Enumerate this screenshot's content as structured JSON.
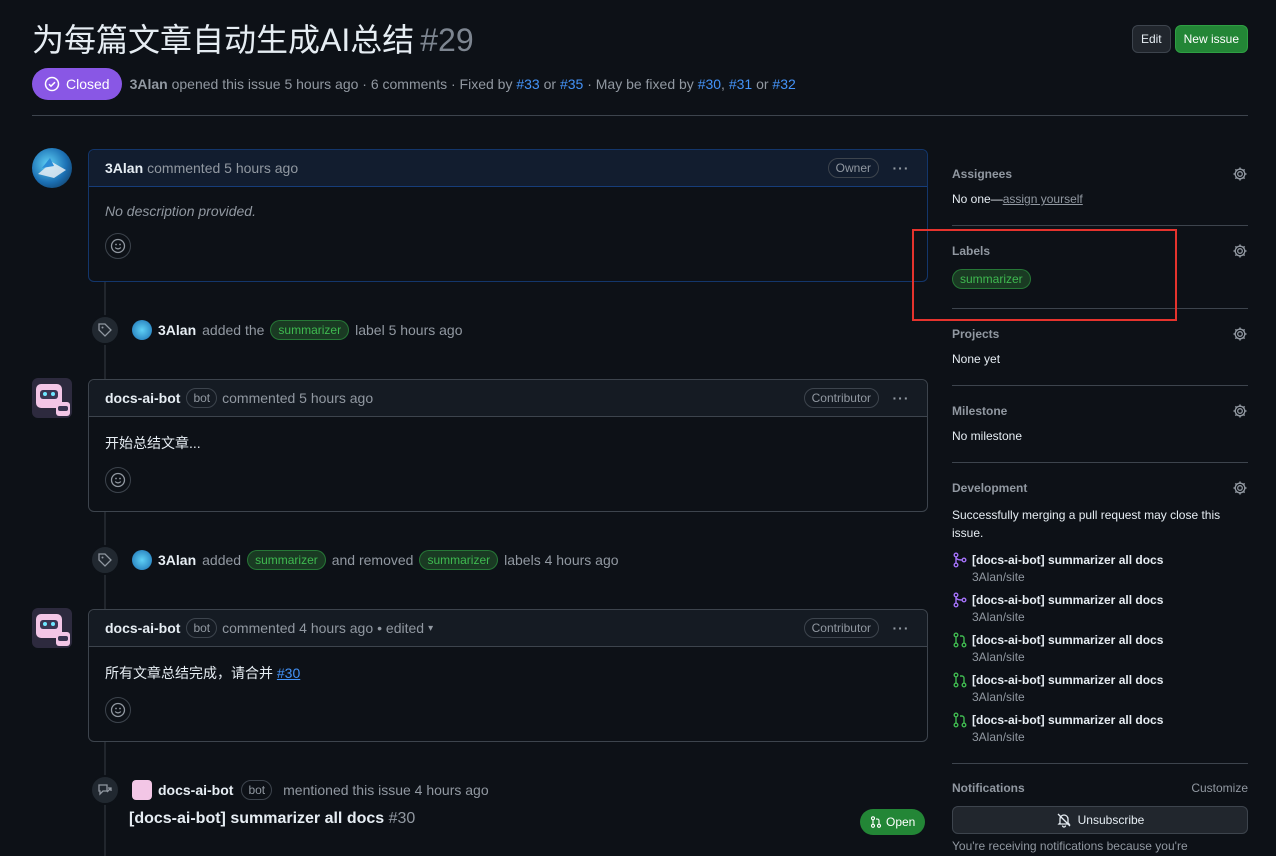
{
  "issue": {
    "title": "为每篇文章自动生成AI总结",
    "number": "#29",
    "state": "Closed",
    "opened_by": "3Alan",
    "opened_text": "opened this issue 5 hours ago · 6 comments · Fixed by",
    "fixed_by": [
      "#33",
      "#35"
    ],
    "or": "or",
    "maybe_text": "· May be fixed by",
    "maybe_fixed_by": [
      "#30",
      "#31",
      "#32"
    ],
    "comma": ","
  },
  "header": {
    "edit_label": "Edit",
    "new_issue_label": "New issue"
  },
  "timeline": {
    "comment1": {
      "author": "3Alan",
      "meta": "commented 5 hours ago",
      "role": "Owner",
      "body": "No description provided."
    },
    "event1": {
      "who": "3Alan",
      "pre": "added the",
      "label": "summarizer",
      "post": "label 5 hours ago"
    },
    "comment2": {
      "author": "docs-ai-bot",
      "bot": "bot",
      "meta": "commented 5 hours ago",
      "role": "Contributor",
      "body": "开始总结文章..."
    },
    "event2": {
      "who": "3Alan",
      "pre": "added",
      "label1": "summarizer",
      "mid": "and removed",
      "label2": "summarizer",
      "post": "labels 4 hours ago"
    },
    "comment3": {
      "author": "docs-ai-bot",
      "bot": "bot",
      "meta": "commented 4 hours ago",
      "edited": "• edited",
      "role": "Contributor",
      "body": "所有文章总结完成，请合并",
      "body_link": "#30"
    },
    "event3": {
      "who": "docs-ai-bot",
      "bot": "bot",
      "post": "mentioned this issue 4 hours ago",
      "ref_title": "[docs-ai-bot] summarizer all docs",
      "ref_num": "#30",
      "ref_state": "Open"
    }
  },
  "sidebar": {
    "assignees": {
      "title": "Assignees",
      "value": "No one—",
      "link": "assign yourself"
    },
    "labels": {
      "title": "Labels",
      "label": "summarizer"
    },
    "projects": {
      "title": "Projects",
      "value": "None yet"
    },
    "milestone": {
      "title": "Milestone",
      "value": "No milestone"
    },
    "development": {
      "title": "Development",
      "desc": "Successfully merging a pull request may close this issue.",
      "prs": [
        {
          "title": "[docs-ai-bot] summarizer all docs",
          "repo": "3Alan/site",
          "state": "merged"
        },
        {
          "title": "[docs-ai-bot] summarizer all docs",
          "repo": "3Alan/site",
          "state": "merged"
        },
        {
          "title": "[docs-ai-bot] summarizer all docs",
          "repo": "3Alan/site",
          "state": "open"
        },
        {
          "title": "[docs-ai-bot] summarizer all docs",
          "repo": "3Alan/site",
          "state": "open"
        },
        {
          "title": "[docs-ai-bot] summarizer all docs",
          "repo": "3Alan/site",
          "state": "open"
        }
      ]
    },
    "notifications": {
      "title": "Notifications",
      "customize": "Customize",
      "unsubscribe": "Unsubscribe",
      "note": "You're receiving notifications because you're"
    }
  },
  "colors": {
    "closed": "#8957e5",
    "open": "#238636",
    "label_fg": "#3fb950",
    "highlight": "#e5332d"
  }
}
